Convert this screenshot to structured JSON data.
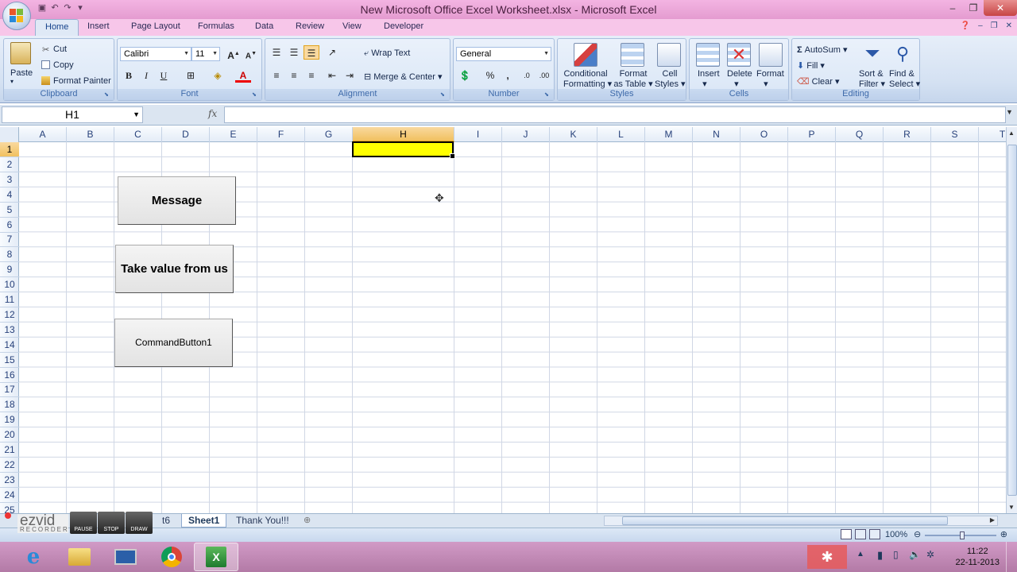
{
  "window": {
    "title": "New Microsoft Office Excel Worksheet.xlsx - Microsoft Excel",
    "minimize": "–",
    "restore": "❐",
    "close": "✕"
  },
  "ribbon_tabs": [
    "Home",
    "Insert",
    "Page Layout",
    "Formulas",
    "Data",
    "Review",
    "View",
    "Developer"
  ],
  "ribbon": {
    "clipboard": {
      "name": "Clipboard",
      "paste": "Paste",
      "cut": "Cut",
      "copy": "Copy",
      "format_painter": "Format Painter"
    },
    "font": {
      "name": "Font",
      "font_name": "Calibri",
      "font_size": "11",
      "bold": "B",
      "italic": "I",
      "underline": "U"
    },
    "alignment": {
      "name": "Alignment",
      "wrap_text": "Wrap Text",
      "merge_center": "Merge & Center"
    },
    "number": {
      "name": "Number",
      "format": "General",
      "percent": "%",
      "comma": ","
    },
    "styles": {
      "name": "Styles",
      "conditional_1": "Conditional",
      "conditional_2": "Formatting",
      "format_table_1": "Format",
      "format_table_2": "as Table",
      "cell_styles_1": "Cell",
      "cell_styles_2": "Styles"
    },
    "cells": {
      "name": "Cells",
      "insert": "Insert",
      "delete": "Delete",
      "format": "Format"
    },
    "editing": {
      "name": "Editing",
      "autosum": "AutoSum",
      "fill": "Fill",
      "clear": "Clear",
      "sort_1": "Sort &",
      "sort_2": "Filter",
      "find_1": "Find &",
      "find_2": "Select"
    }
  },
  "formula_bar": {
    "name_box": "H1",
    "fx": "fx",
    "value": ""
  },
  "columns": [
    "A",
    "B",
    "C",
    "D",
    "E",
    "F",
    "G",
    "H",
    "I",
    "J",
    "K",
    "L",
    "M",
    "N",
    "O",
    "P",
    "Q",
    "R",
    "S",
    "T"
  ],
  "rows": [
    "1",
    "2",
    "3",
    "4",
    "5",
    "6",
    "7",
    "8",
    "9",
    "10",
    "11",
    "12",
    "13",
    "14",
    "15",
    "16",
    "17",
    "18",
    "19",
    "20",
    "21",
    "22",
    "23",
    "24",
    "25"
  ],
  "selected_cell": {
    "column": "H",
    "row": "1",
    "fill": "#ffff00"
  },
  "buttons": {
    "message": "Message",
    "take_value": "Take value from us",
    "command1": "CommandButton1"
  },
  "sheet_tabs": {
    "partial": "t6",
    "active": "Sheet1",
    "other": "Thank You!!!"
  },
  "status": {
    "zoom": "100%"
  },
  "recorder": {
    "logo": "ezvid",
    "sub": "RECORDER",
    "pause": "PAUSE",
    "stop": "STOP",
    "draw": "DRAW"
  },
  "clock": {
    "time": "11:22",
    "date": "22-11-2013"
  },
  "colors": {
    "titlebar": "#e49bd0",
    "ribbon": "#d4e1f2",
    "selection": "#ffff00",
    "taskbar": "#b37aa6"
  }
}
